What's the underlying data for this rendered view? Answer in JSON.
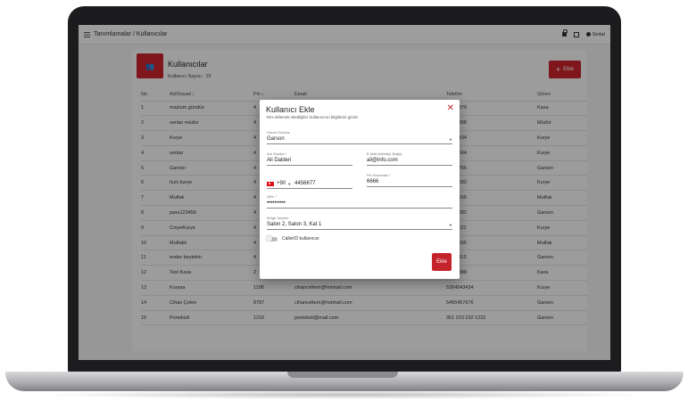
{
  "topbar": {
    "breadcrumb": "Tanımlamalar / Kullanıcılar",
    "user_name": "Sedat"
  },
  "header": {
    "badge_glyph": "&#x1F465;",
    "title": "Kullanıcılar",
    "user_count": "Kullanıcı Sayısı : 15",
    "add_button": "Ekle"
  },
  "table": {
    "columns": [
      "No",
      "Ad/Soyad ↓",
      "Pin ↓",
      "Email",
      "Telefon",
      "Görev"
    ],
    "rows": [
      [
        "1",
        "mazlum gündüz",
        "4",
        "",
        "...136379",
        "Kasa"
      ],
      [
        "2",
        "sentar müdür",
        "4",
        "",
        "...158898",
        "Müdür"
      ],
      [
        "3",
        "Kurye",
        "4",
        "",
        "...433434",
        "Kurye"
      ],
      [
        "4",
        "sentar",
        "4",
        "",
        "...156664",
        "Kurye"
      ],
      [
        "5",
        "Garson",
        "4",
        "",
        "...567766",
        "Garson"
      ],
      [
        "6",
        "hızlı kurye",
        "4",
        "",
        "...128282",
        "Kurye"
      ],
      [
        "7",
        "Mutfak",
        "4",
        "",
        "...555555",
        "Mutfak"
      ],
      [
        "8",
        "pass123456",
        "4",
        "",
        "...128282",
        "Garson"
      ],
      [
        "9",
        "CmyeKurye",
        "4",
        "",
        "...113131",
        "Kurye"
      ],
      [
        "10",
        "Mutfakk",
        "4",
        "",
        "...133565",
        "Mutfak"
      ],
      [
        "11",
        "ender beytekin",
        "4",
        "",
        "...116813",
        "Garson"
      ],
      [
        "12",
        "Test Kasa",
        "2",
        "",
        "...177888",
        "Kasa"
      ],
      [
        "13",
        "Kuryaa",
        "1198",
        "cihanceltem@hotmail.com",
        "5364543434",
        "Kurye"
      ],
      [
        "14",
        "Cihan Çelen",
        "8787",
        "cihanceltem@hotmail.com",
        "5455457676",
        "Garson"
      ],
      [
        "15",
        "Portekizli",
        "1215",
        "portekizli@mail.com",
        "351 223 232 1232",
        "Garson"
      ]
    ]
  },
  "modal": {
    "title": "Kullanıcı Ekle",
    "subtitle": "Yeni eklemek istediğiniz kullanıcının bilgilerini giriniz",
    "role_label": "Görevi Seçiniz",
    "role_value": "Garson",
    "name_label": "Adı Soyadı *",
    "name_value": "Ali Dalderi",
    "email_label": "E-Mail (eklediğ. Bağlı)",
    "email_value": "ali@info.com",
    "phone_code": "+90",
    "phone_value": "4456677",
    "pin_label": "Pin Numarası *",
    "pin_value": "6666",
    "password_label": "Şifre *",
    "password_value": "••••••••••",
    "location_label": "Bölge Seçiniz",
    "location_value": "Salon 2, Salon 3, Kat 1",
    "toggle_label": "CallerID kullanıcısı",
    "add_button": "Ekle"
  },
  "colors": {
    "accent": "#c5232b"
  }
}
